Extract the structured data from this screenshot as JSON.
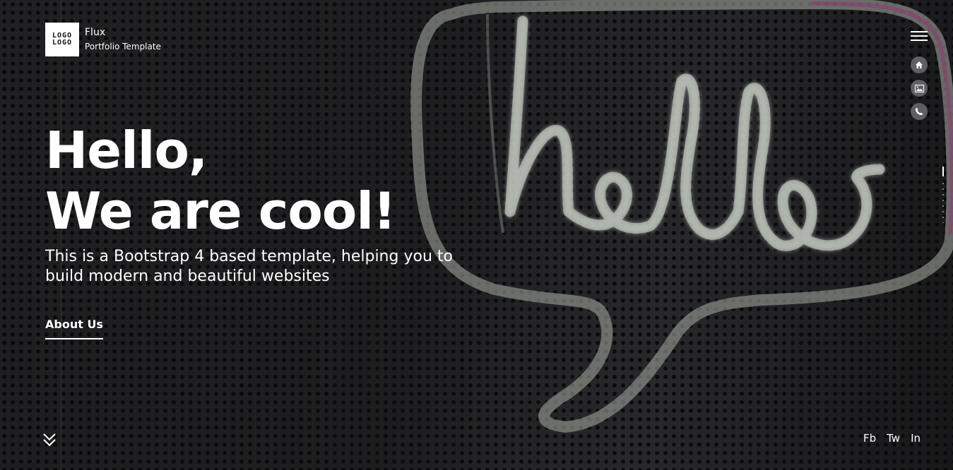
{
  "brand": {
    "logo_line1": "LOGO",
    "logo_line2": "LOGO",
    "name": "Flux",
    "tagline": "Portfolio Template"
  },
  "nav": {
    "menu_icon": "hamburger-icon",
    "items": [
      {
        "icon": "home-icon"
      },
      {
        "icon": "image-icon"
      },
      {
        "icon": "phone-icon"
      }
    ]
  },
  "hero": {
    "headline_line1": "Hello,",
    "headline_line2": "We are cool!",
    "lead": "This is a Bootstrap 4 based template, helping you to build modern and beautiful websites",
    "cta_label": "About Us",
    "scroll_icon": "chevron-double-down-icon",
    "background_neon_text": "hello"
  },
  "social": {
    "fb": "Fb",
    "tw": "Tw",
    "in": "In"
  },
  "colors": {
    "background": "#232325",
    "text": "#ffffff",
    "neon_tube": "#c9cec6",
    "neon_pink": "#8c3a6e"
  }
}
